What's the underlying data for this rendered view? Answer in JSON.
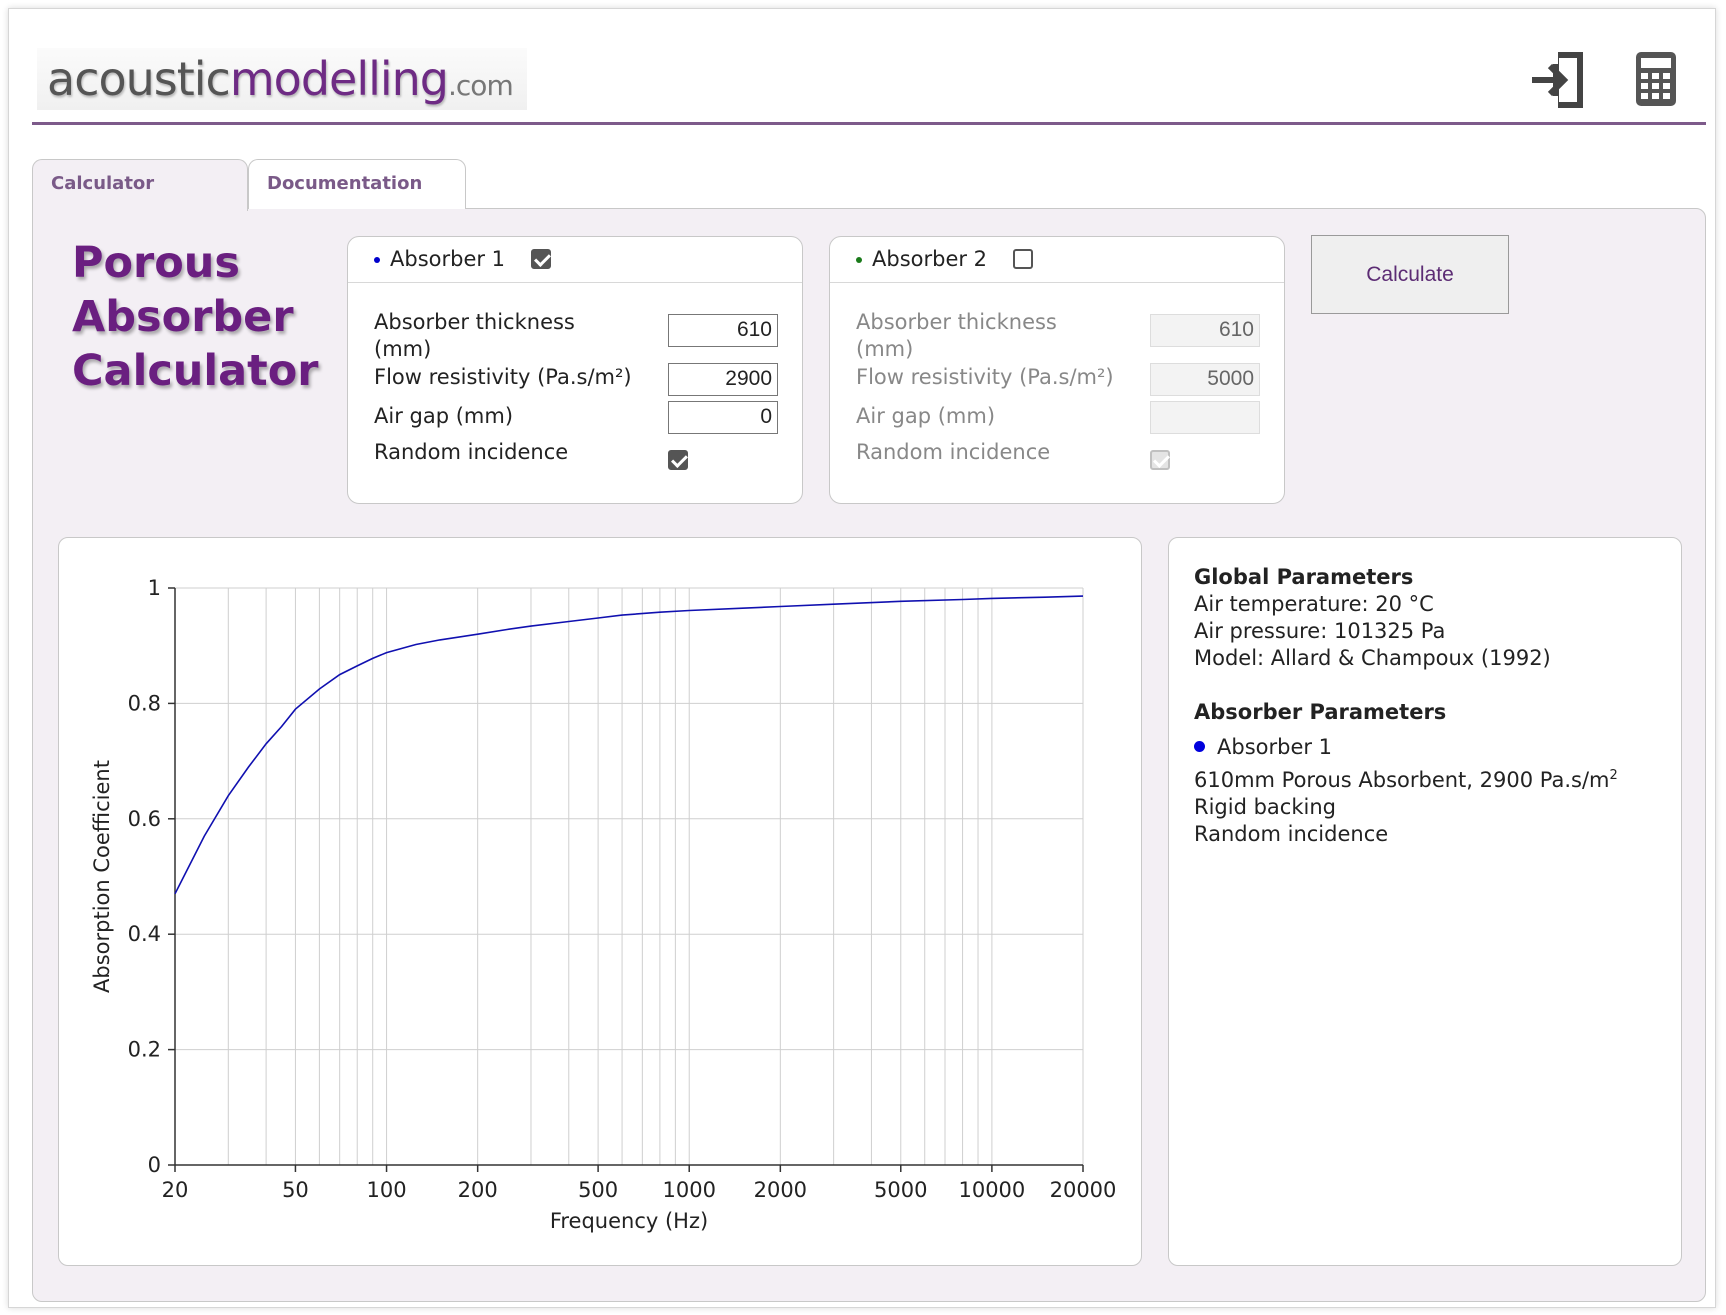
{
  "header": {
    "logo_part1": "acoustic",
    "logo_part2": "modelling",
    "logo_part3": ".com",
    "login_icon": "sign-in-icon",
    "calculator_icon": "calculator-icon"
  },
  "tabs": [
    {
      "label": "Calculator",
      "active": true
    },
    {
      "label": "Documentation",
      "active": false
    }
  ],
  "title": {
    "line1": "Porous",
    "line2": "Absorber",
    "line3": "Calculator"
  },
  "absorber1": {
    "label": "Absorber 1",
    "enabled": true,
    "dot_color": "#0000cc",
    "thickness_label_1": "Absorber thickness",
    "thickness_label_2": "(mm)",
    "thickness": "610",
    "flow_label": "Flow resistivity (Pa.s/m²)",
    "flow": "2900",
    "airgap_label": "Air gap (mm)",
    "airgap": "0",
    "random_label": "Random incidence",
    "random": true
  },
  "absorber2": {
    "label": "Absorber 2",
    "enabled": false,
    "dot_color": "#1a7a1a",
    "thickness_label_1": "Absorber thickness",
    "thickness_label_2": "(mm)",
    "thickness": "610",
    "flow_label": "Flow resistivity (Pa.s/m²)",
    "flow": "5000",
    "airgap_label": "Air gap (mm)",
    "airgap": "",
    "random_label": "Random incidence",
    "random": true
  },
  "calculate_label": "Calculate",
  "info": {
    "global_heading": "Global Parameters",
    "air_temp": "Air temperature: 20 °C",
    "air_pressure": "Air pressure: 101325 Pa",
    "model": "Model: Allard & Champoux (1992)",
    "absorber_heading": "Absorber Parameters",
    "absorber_name": "Absorber 1",
    "absorber_desc": "610mm Porous Absorbent, 2900 Pa.s/m",
    "absorber_desc_sup": "2",
    "backing": "Rigid backing",
    "incidence": "Random incidence"
  },
  "chart_data": {
    "type": "line",
    "xlabel": "Frequency (Hz)",
    "ylabel": "Absorption Coefficient",
    "xscale": "log",
    "xlim": [
      20,
      20000
    ],
    "ylim": [
      0,
      1
    ],
    "xticks": [
      20,
      50,
      100,
      200,
      500,
      1000,
      2000,
      5000,
      10000,
      20000
    ],
    "xtick_labels": [
      "20",
      "50",
      "100",
      "200",
      "500",
      "1000",
      "2000",
      "5000",
      "10000",
      "20000"
    ],
    "yticks": [
      0,
      0.2,
      0.4,
      0.6,
      0.8,
      1
    ],
    "ytick_labels": [
      "0",
      "0.2",
      "0.4",
      "0.6",
      "0.8",
      "1"
    ],
    "grid": true,
    "series": [
      {
        "color": "#1010b0",
        "x": [
          20,
          25,
          30,
          35,
          40,
          45,
          50,
          60,
          70,
          80,
          90,
          100,
          125,
          150,
          200,
          250,
          300,
          400,
          500,
          600,
          800,
          1000,
          1500,
          2000,
          3000,
          5000,
          8000,
          10000,
          15000,
          20000
        ],
        "y": [
          0.47,
          0.57,
          0.64,
          0.69,
          0.73,
          0.76,
          0.79,
          0.825,
          0.85,
          0.865,
          0.878,
          0.888,
          0.902,
          0.91,
          0.92,
          0.928,
          0.934,
          0.942,
          0.948,
          0.953,
          0.958,
          0.961,
          0.965,
          0.968,
          0.972,
          0.977,
          0.98,
          0.982,
          0.984,
          0.986
        ]
      }
    ]
  }
}
